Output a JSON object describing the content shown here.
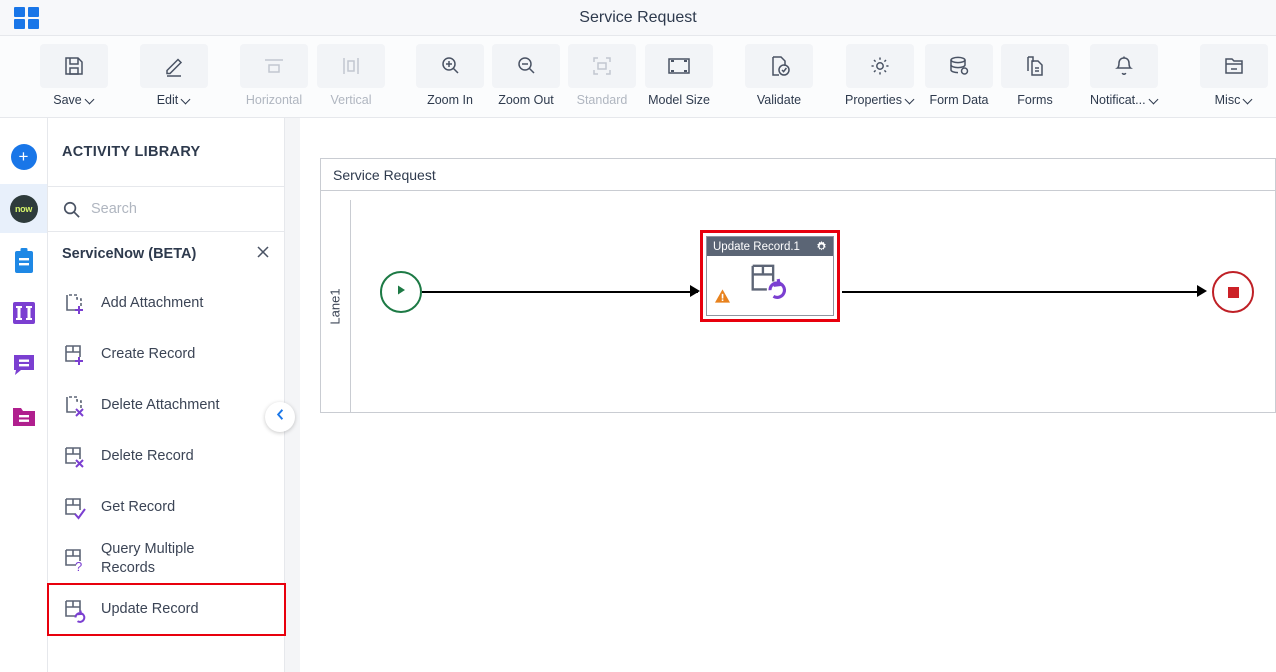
{
  "header": {
    "title": "Service Request",
    "app_icon": "grid-icon"
  },
  "toolbar": {
    "items": [
      {
        "label": "Save",
        "icon": "save-icon",
        "caret": true,
        "disabled": false
      },
      {
        "label": "Edit",
        "icon": "pencil-icon",
        "caret": true,
        "disabled": false
      },
      {
        "label": "Horizontal",
        "icon": "horizontal-icon",
        "caret": false,
        "disabled": true
      },
      {
        "label": "Vertical",
        "icon": "vertical-icon",
        "caret": false,
        "disabled": true
      },
      {
        "label": "Zoom In",
        "icon": "zoom-in-icon",
        "caret": false,
        "disabled": false
      },
      {
        "label": "Zoom Out",
        "icon": "zoom-out-icon",
        "caret": false,
        "disabled": false
      },
      {
        "label": "Standard",
        "icon": "standard-size-icon",
        "caret": false,
        "disabled": true
      },
      {
        "label": "Model Size",
        "icon": "model-size-icon",
        "caret": false,
        "disabled": false
      },
      {
        "label": "Validate",
        "icon": "validate-icon",
        "caret": false,
        "disabled": false
      },
      {
        "label": "Properties",
        "icon": "gear-icon",
        "caret": true,
        "disabled": false
      },
      {
        "label": "Form Data",
        "icon": "database-icon",
        "caret": false,
        "disabled": false
      },
      {
        "label": "Forms",
        "icon": "document-icon",
        "caret": false,
        "disabled": false
      },
      {
        "label": "Notificat...",
        "icon": "bell-icon",
        "caret": true,
        "disabled": false
      },
      {
        "label": "Misc",
        "icon": "folder-icon",
        "caret": true,
        "disabled": false
      }
    ]
  },
  "icon_rail": {
    "items": [
      {
        "name": "add-button",
        "icon": "plus-circle-icon",
        "selected": false,
        "color": "#1976e8"
      },
      {
        "name": "servicenow-button",
        "icon": "now-logo-icon",
        "selected": true,
        "color": "#2e3b3b"
      },
      {
        "name": "clipboard-button",
        "icon": "clipboard-icon",
        "selected": false,
        "color": "#1e88e5"
      },
      {
        "name": "columns-button",
        "icon": "columns-icon",
        "selected": false,
        "color": "#7b3fd1"
      },
      {
        "name": "comment-button",
        "icon": "comment-icon",
        "selected": false,
        "color": "#7b3fd1"
      },
      {
        "name": "folder-button",
        "icon": "folder-lines-icon",
        "selected": false,
        "color": "#b01f8e"
      }
    ]
  },
  "library": {
    "title": "ACTIVITY LIBRARY",
    "search": {
      "value": "",
      "placeholder": "Search"
    },
    "group": {
      "label": "ServiceNow (BETA)",
      "close_icon": "close-icon"
    },
    "activities": [
      {
        "label": "Add Attachment",
        "icon": "attachment-add-icon",
        "highlighted": false
      },
      {
        "label": "Create Record",
        "icon": "record-add-icon",
        "highlighted": false
      },
      {
        "label": "Delete Attachment",
        "icon": "attachment-delete-icon",
        "highlighted": false
      },
      {
        "label": "Delete Record",
        "icon": "record-delete-icon",
        "highlighted": false
      },
      {
        "label": "Get Record",
        "icon": "record-check-icon",
        "highlighted": false
      },
      {
        "label": "Query Multiple Records",
        "icon": "record-query-icon",
        "highlighted": false
      },
      {
        "label": "Update Record",
        "icon": "record-update-icon",
        "highlighted": true
      }
    ],
    "collapse_icon": "chevron-left-icon"
  },
  "canvas": {
    "pool_title": "Service Request",
    "lane_label": "Lane1",
    "start_node": {
      "name": "start-event",
      "icon": "play-icon",
      "color": "#1d7a45"
    },
    "end_node": {
      "name": "end-event",
      "icon": "stop-icon",
      "color": "#bf2026"
    },
    "task": {
      "title": "Update Record.1",
      "gear_icon": "gear-icon",
      "warning_icon": "warning-icon",
      "glyph_icon": "record-update-icon",
      "titlebar_color": "#5b6575",
      "selection_color": "#e8000d",
      "warning_color": "#e8821e"
    }
  },
  "colors": {
    "accent": "#1976e8",
    "highlight": "#e8000d",
    "purple": "#7b3fd1",
    "text": "#2e3a4d"
  }
}
